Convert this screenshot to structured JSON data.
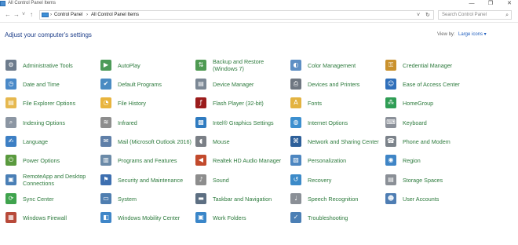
{
  "window": {
    "title": "All Control Panel Items",
    "minimize_glyph": "—",
    "maximize_glyph": "❐",
    "close_glyph": "✕"
  },
  "address_bar": {
    "back_glyph": "←",
    "forward_glyph": "→",
    "recent_glyph": "˅",
    "up_glyph": "↑",
    "separator_glyph": "›",
    "crumbs": [
      "Control Panel",
      "All Control Panel Items"
    ],
    "dropdown_glyph": "˅",
    "refresh_glyph": "↻"
  },
  "search": {
    "placeholder": "Search Control Panel",
    "icon_glyph": "⌕"
  },
  "header": {
    "title": "Adjust your computer's settings"
  },
  "view_by": {
    "label": "View by:",
    "value": "Large icons ▾"
  },
  "items": [
    {
      "label": "Administrative Tools",
      "icon": "tools-icon",
      "color": "#6d7b8c",
      "glyph": "⚙"
    },
    {
      "label": "Date and Time",
      "icon": "clock-icon",
      "color": "#4a89c8",
      "glyph": "◷"
    },
    {
      "label": "File Explorer Options",
      "icon": "folder-options-icon",
      "color": "#e6b84f",
      "glyph": "▤"
    },
    {
      "label": "Indexing Options",
      "icon": "indexing-icon",
      "color": "#8c96a3",
      "glyph": "⌕"
    },
    {
      "label": "Language",
      "icon": "language-icon",
      "color": "#3d7fc4",
      "glyph": "✍"
    },
    {
      "label": "Power Options",
      "icon": "power-icon",
      "color": "#5a9a3e",
      "glyph": "⏻"
    },
    {
      "label": "RemoteApp and Desktop Connections",
      "icon": "remote-desktop-icon",
      "color": "#4a7fb6",
      "glyph": "▣"
    },
    {
      "label": "Sync Center",
      "icon": "sync-icon",
      "color": "#3fa34d",
      "glyph": "⟳"
    },
    {
      "label": "Windows Firewall",
      "icon": "firewall-icon",
      "color": "#b84a3a",
      "glyph": "▦"
    },
    {
      "label": "AutoPlay",
      "icon": "autoplay-icon",
      "color": "#4c9a58",
      "glyph": "▶"
    },
    {
      "label": "Default Programs",
      "icon": "default-programs-icon",
      "color": "#4a8bc2",
      "glyph": "✔"
    },
    {
      "label": "File History",
      "icon": "file-history-icon",
      "color": "#e8b43e",
      "glyph": "◔"
    },
    {
      "label": "Infrared",
      "icon": "infrared-icon",
      "color": "#8d8d8d",
      "glyph": "≋"
    },
    {
      "label": "Mail (Microsoft Outlook 2016)",
      "icon": "mail-icon",
      "color": "#5f7fa8",
      "glyph": "✉"
    },
    {
      "label": "Programs and Features",
      "icon": "programs-icon",
      "color": "#6b8aa8",
      "glyph": "▥"
    },
    {
      "label": "Security and Maintenance",
      "icon": "flag-icon",
      "color": "#3d6fb0",
      "glyph": "⚑"
    },
    {
      "label": "System",
      "icon": "system-icon",
      "color": "#4f7eb0",
      "glyph": "▭"
    },
    {
      "label": "Windows Mobility Center",
      "icon": "mobility-icon",
      "color": "#3f86c8",
      "glyph": "◧"
    },
    {
      "label": "Backup and Restore (Windows 7)",
      "icon": "backup-icon",
      "color": "#4e9a52",
      "glyph": "⇅"
    },
    {
      "label": "Device Manager",
      "icon": "device-manager-icon",
      "color": "#7b8794",
      "glyph": "▤"
    },
    {
      "label": "Flash Player (32-bit)",
      "icon": "flash-icon",
      "color": "#9b1c1c",
      "glyph": "ƒ"
    },
    {
      "label": "Intel® Graphics Settings",
      "icon": "intel-graphics-icon",
      "color": "#2f7bc0",
      "glyph": "▩"
    },
    {
      "label": "Mouse",
      "icon": "mouse-icon",
      "color": "#7a7f86",
      "glyph": "◖"
    },
    {
      "label": "Realtek HD Audio Manager",
      "icon": "speaker-icon",
      "color": "#c24a2c",
      "glyph": "◀"
    },
    {
      "label": "Sound",
      "icon": "sound-icon",
      "color": "#8d8d8d",
      "glyph": "♪"
    },
    {
      "label": "Taskbar and Navigation",
      "icon": "taskbar-icon",
      "color": "#5d6f82",
      "glyph": "▬"
    },
    {
      "label": "Work Folders",
      "icon": "work-folders-icon",
      "color": "#3a86c9",
      "glyph": "▣"
    },
    {
      "label": "Color Management",
      "icon": "color-management-icon",
      "color": "#5e8fc4",
      "glyph": "◐"
    },
    {
      "label": "Devices and Printers",
      "icon": "printer-icon",
      "color": "#6e7680",
      "glyph": "⎙"
    },
    {
      "label": "Fonts",
      "icon": "fonts-icon",
      "color": "#e3b341",
      "glyph": "A"
    },
    {
      "label": "Internet Options",
      "icon": "internet-icon",
      "color": "#3c8fcf",
      "glyph": "◍"
    },
    {
      "label": "Network and Sharing Center",
      "icon": "network-icon",
      "color": "#2d5f99",
      "glyph": "⌘"
    },
    {
      "label": "Personalization",
      "icon": "personalization-icon",
      "color": "#4d86c0",
      "glyph": "▧"
    },
    {
      "label": "Recovery",
      "icon": "recovery-icon",
      "color": "#3c8ac8",
      "glyph": "↺"
    },
    {
      "label": "Speech Recognition",
      "icon": "microphone-icon",
      "color": "#8a8f96",
      "glyph": "♩"
    },
    {
      "label": "Troubleshooting",
      "icon": "troubleshooting-icon",
      "color": "#4b7fb5",
      "glyph": "✓"
    },
    {
      "label": "Credential Manager",
      "icon": "credential-icon",
      "color": "#c9912d",
      "glyph": "⚿"
    },
    {
      "label": "Ease of Access Center",
      "icon": "ease-of-access-icon",
      "color": "#2f6fba",
      "glyph": "☺"
    },
    {
      "label": "HomeGroup",
      "icon": "homegroup-icon",
      "color": "#2f9d55",
      "glyph": "⁂"
    },
    {
      "label": "Keyboard",
      "icon": "keyboard-icon",
      "color": "#8b9099",
      "glyph": "⌨"
    },
    {
      "label": "Phone and Modem",
      "icon": "phone-icon",
      "color": "#7b828a",
      "glyph": "☎"
    },
    {
      "label": "Region",
      "icon": "region-icon",
      "color": "#3f85c6",
      "glyph": "◉"
    },
    {
      "label": "Storage Spaces",
      "icon": "storage-icon",
      "color": "#8a8f96",
      "glyph": "▤"
    },
    {
      "label": "User Accounts",
      "icon": "user-accounts-icon",
      "color": "#4e7db3",
      "glyph": "☻"
    }
  ]
}
